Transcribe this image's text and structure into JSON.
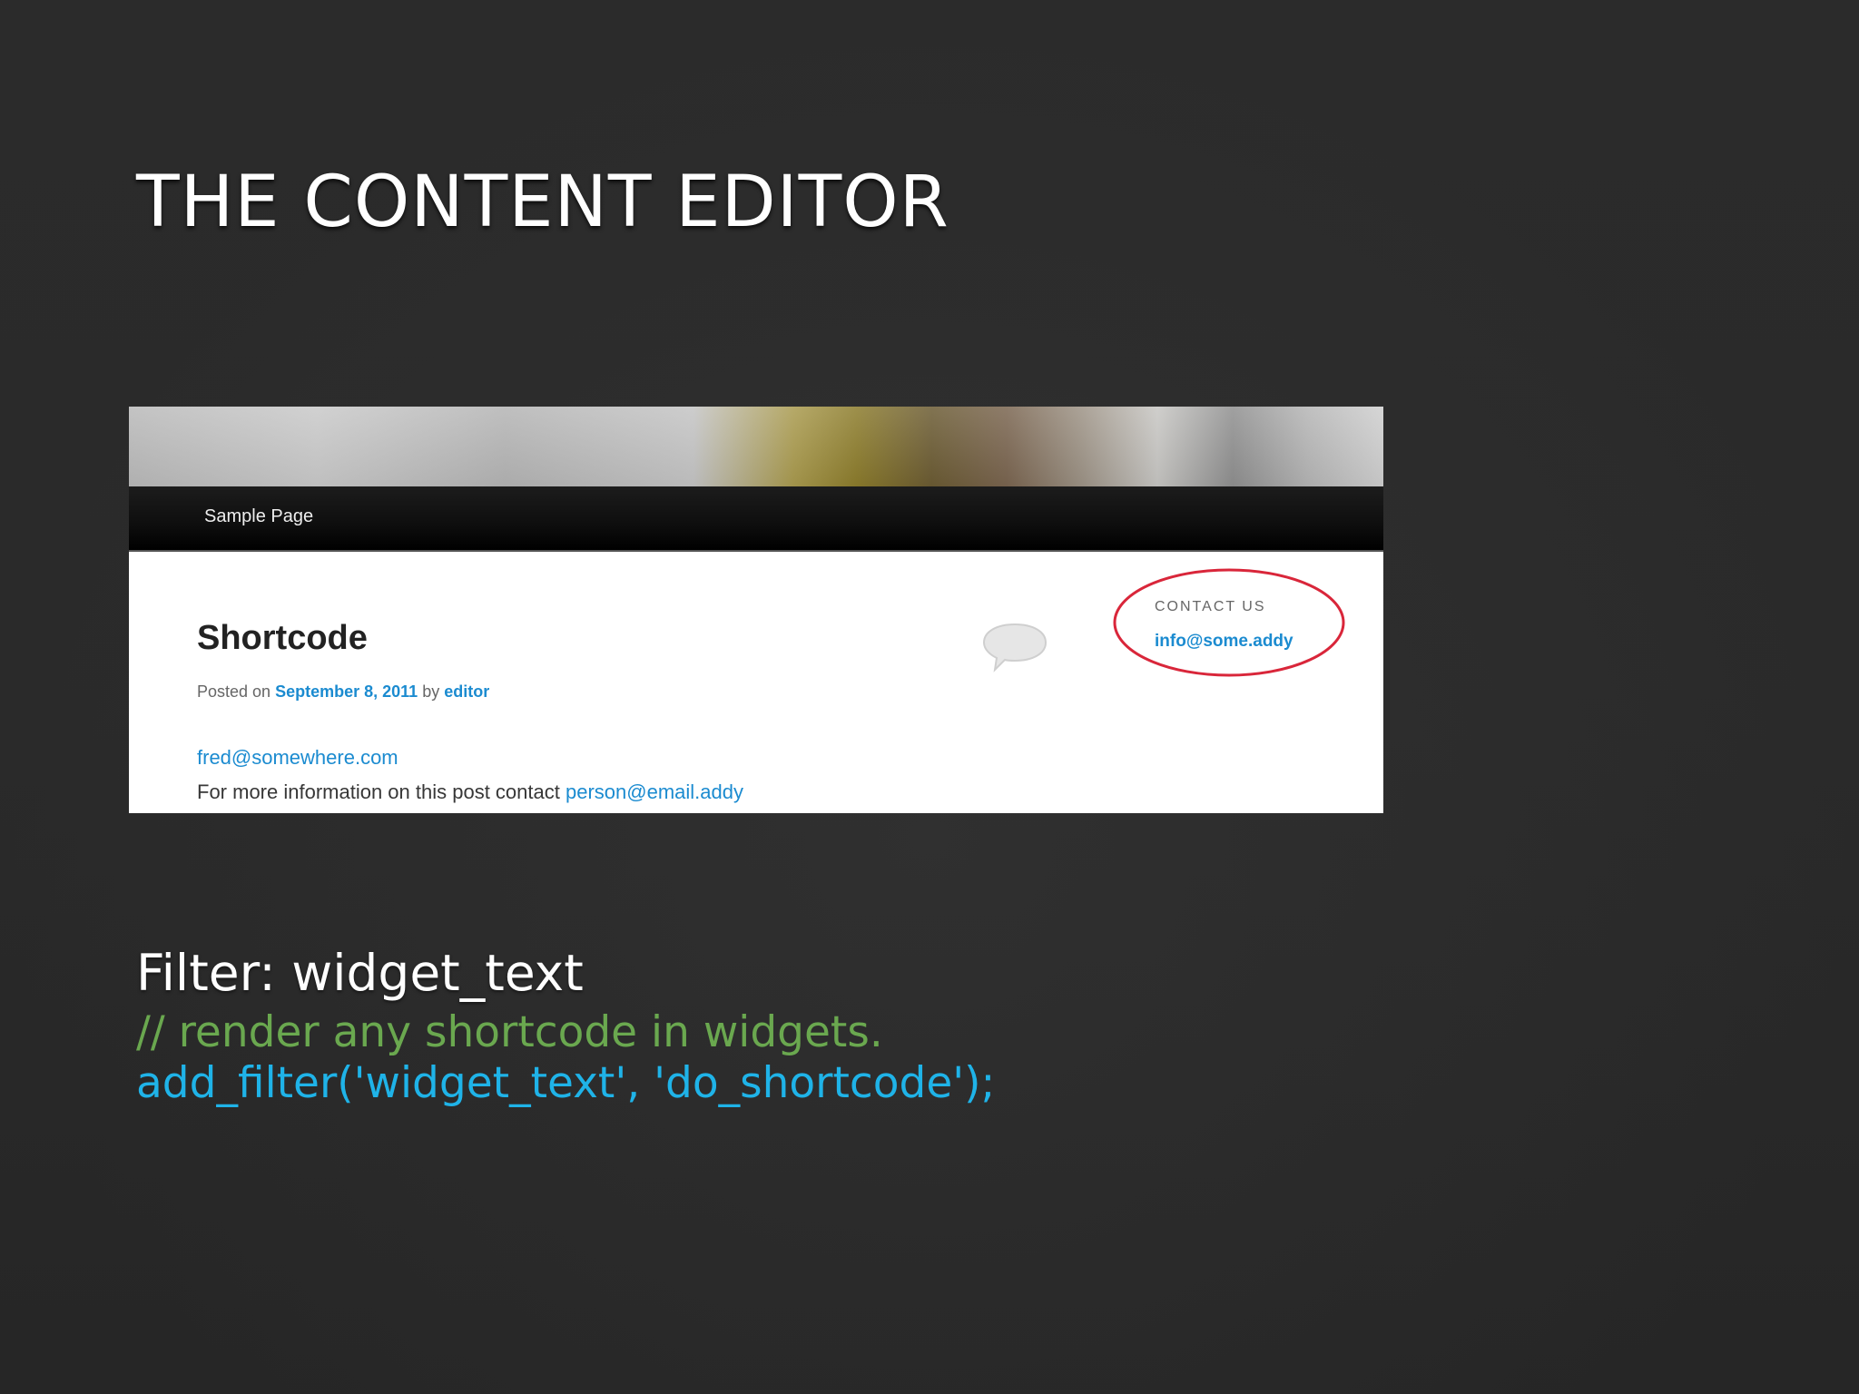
{
  "slide": {
    "title": "THE CONTENT EDITOR",
    "filter_text": "Filter: widget_text",
    "comment_text": "// render any shortcode in widgets.",
    "code_text": "add_filter('widget_text', 'do_shortcode');"
  },
  "website": {
    "nav": {
      "items": [
        {
          "label": "Sample Page"
        }
      ]
    },
    "post": {
      "title": "Shortcode",
      "meta": {
        "posted_on_label": "Posted on",
        "date": "September 8, 2011",
        "by_label": "by",
        "author": "editor"
      },
      "content": {
        "email": "fred@somewhere.com",
        "info_prefix": "For more information on this post contact",
        "info_email": "person@email.addy"
      }
    },
    "sidebar": {
      "widget_heading": "CONTACT US",
      "widget_email": "info@some.addy"
    },
    "icons": {
      "comment": "comment-bubble-icon"
    }
  },
  "colors": {
    "background": "#2a2a2a",
    "title_text": "#ffffff",
    "comment_code": "#6aa84f",
    "code": "#1fb3e8",
    "link": "#1b8bd0",
    "highlight_circle": "#d9263a"
  }
}
